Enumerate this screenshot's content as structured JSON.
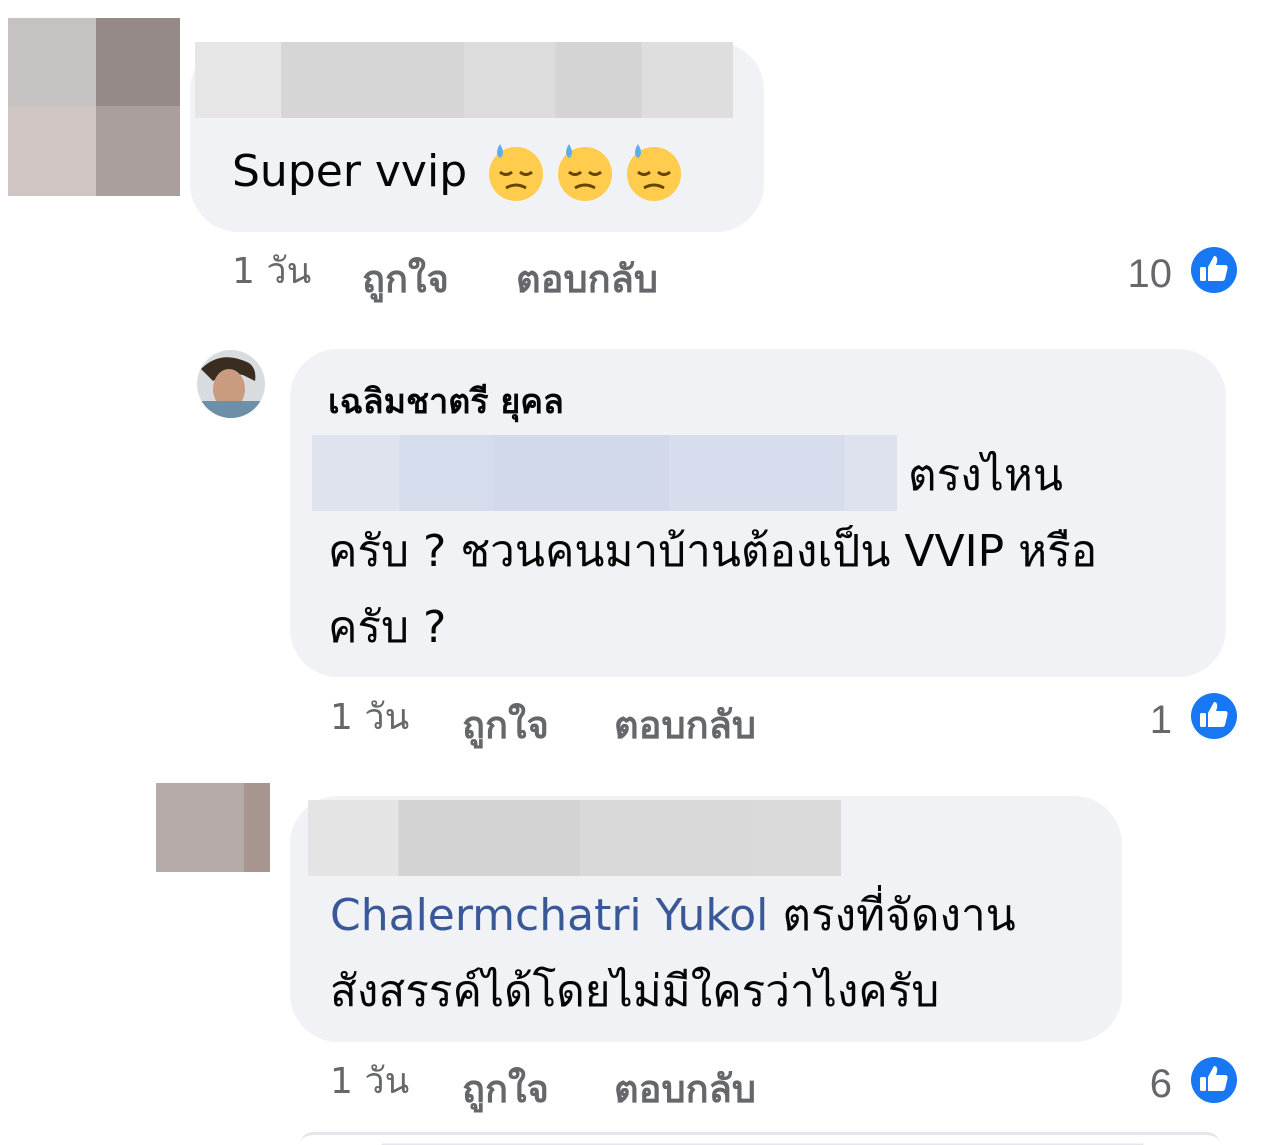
{
  "comments": [
    {
      "text": "Super vvip",
      "emojis": [
        "downcast-face-with-sweat",
        "downcast-face-with-sweat",
        "downcast-face-with-sweat"
      ],
      "time": "1 วัน",
      "like_label": "ถูกใจ",
      "reply_label": "ตอบกลับ",
      "likes": "10"
    },
    {
      "author": "เฉลิมชาตรี ยุคล",
      "text_line1": "ตรงไหน",
      "text_line2": "ครับ ? ชวนคนมาบ้านต้องเป็น VVIP หรือ",
      "text_line3": "ครับ ?",
      "time": "1 วัน",
      "like_label": "ถูกใจ",
      "reply_label": "ตอบกลับ",
      "likes": "1"
    },
    {
      "mention": "Chalermchatri Yukol",
      "text_line1": " ตรงที่จัดงาน",
      "text_line2": "สังสรรค์ได้โดยไม่มีใครว่าไงครับ",
      "time": "1 วัน",
      "like_label": "ถูกใจ",
      "reply_label": "ตอบกลับ",
      "likes": "6"
    }
  ],
  "colors": {
    "bubble": "#f0f2f5",
    "secondary_text": "#65676b",
    "mention": "#385898",
    "like_blue": "#1877f2"
  }
}
